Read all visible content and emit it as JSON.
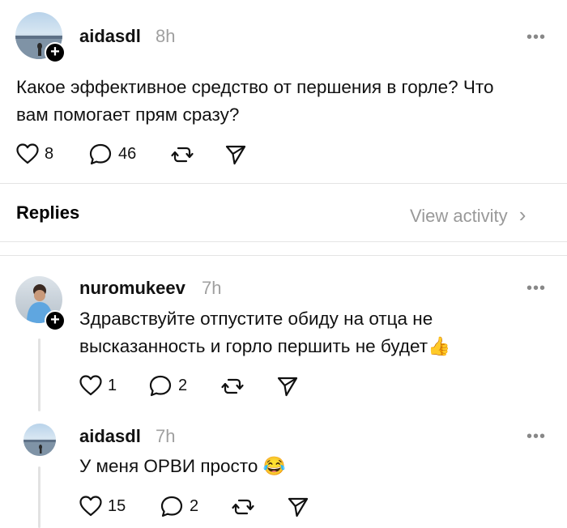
{
  "post": {
    "username": "aidasdl",
    "time": "8h",
    "text_line1": "Какое эффективное средство от першения в горле? Что",
    "text_line2": "вам помогает прям сразу?",
    "likes": "8",
    "comments": "46"
  },
  "replies_header": {
    "title": "Replies",
    "view_activity": "View activity"
  },
  "replies": [
    {
      "username": "nuromukeev",
      "time": "7h",
      "text_line1": "Здравствуйте отпустите обиду на отца не",
      "text_line2": "высказанность и горло першить не будет",
      "emoji": "👍",
      "likes": "1",
      "comments": "2"
    },
    {
      "username": "aidasdl",
      "time": "7h",
      "text_line1": "У меня ОРВИ просто",
      "emoji": "😂",
      "likes": "15",
      "comments": "2"
    }
  ],
  "icons": {
    "follow": "+",
    "more": "•••",
    "chevron": "›"
  }
}
